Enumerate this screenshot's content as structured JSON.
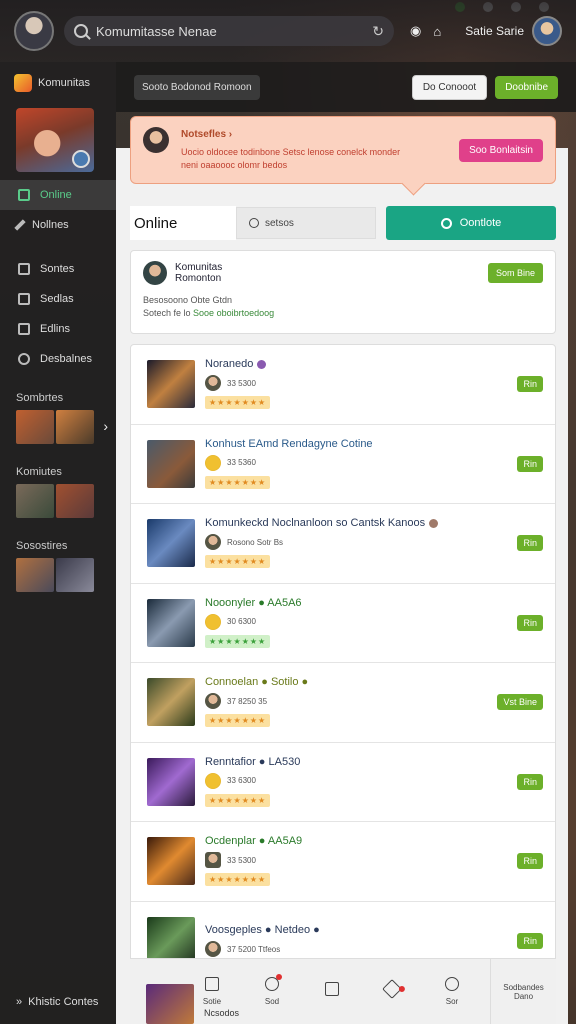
{
  "topbar": {
    "search_text": "Komumitasse Nenae",
    "username": "Satie Sarie",
    "refresh_icon": "refresh-icon",
    "bell_icon": "bell-icon"
  },
  "sidebar": {
    "brand": "Komunitas",
    "items": [
      {
        "label": "Online",
        "icon": "online-icon"
      },
      {
        "label": "Nollnes",
        "icon": "pencil-icon"
      },
      {
        "label": "Sontes",
        "icon": "grid-icon"
      },
      {
        "label": "Sedlas",
        "icon": "list-icon"
      },
      {
        "label": "Edlins",
        "icon": "edit-icon"
      },
      {
        "label": "Desbalnes",
        "icon": "clock-icon"
      }
    ],
    "sections": [
      "Sombrtes",
      "Komiutes",
      "Sosostires"
    ],
    "footer": "Khistic Contes"
  },
  "main_header": {
    "pill": "Sooto Bodonod Romoon",
    "btn_white": "Do Conooot",
    "btn_green": "Doobnibe"
  },
  "notification": {
    "title": "Notsefles",
    "body_1": "Uocio oldocee todinbone Setsc lenose conelck monder",
    "body_2": "neni oaaoooc olomr bedos",
    "button": "Soo Bonlaitsin"
  },
  "tabs": {
    "online": "Online",
    "search": "setsos",
    "search_button": "Oontlote"
  },
  "community_card": {
    "name_1": "Komunitas",
    "name_2": "Romonton",
    "button": "Som Bine",
    "line1": "Besosoono Obte Gtdn",
    "line2_prefix": "Sotech fe lo",
    "line2_highlight": "Sooe oboibrtoedoog"
  },
  "games": [
    {
      "title": "Noranedo",
      "meta": "33 5300",
      "stars": "★★★★★★★",
      "button": "Rin",
      "title_color": "#2a3a5a",
      "dot": "#8a5ab0",
      "star_style": "orange"
    },
    {
      "title": "Konhust EAmd Rendagyne Cotine",
      "meta": "33 5360",
      "stars": "★★★★★★★",
      "button": "Rin",
      "title_color": "#2a5a8a",
      "dot": "",
      "star_style": "orange"
    },
    {
      "title": "Komunkeckd Noclnanloon so Cantsk Kanoos",
      "meta": "Rosono Sotr Bs",
      "stars": "★★★★★★★",
      "button": "Rin",
      "title_color": "#2a3a5a",
      "dot": "#a07a6a",
      "star_style": "orange"
    },
    {
      "title": "Nooonyler ● AA5A6",
      "meta": "30 6300",
      "stars": "★★★★★★★",
      "button": "Rin",
      "title_color": "#2a7a2a",
      "dot": "",
      "star_style": "green"
    },
    {
      "title": "Connoelan ● Sotilo ●",
      "meta": "37 8250 35",
      "stars": "★★★★★★★",
      "button": "Vst Bine",
      "title_color": "#6a7a1a",
      "dot": "",
      "star_style": "orange"
    },
    {
      "title": "Renntafior ● LA530",
      "meta": "33 6300",
      "stars": "★★★★★★★",
      "button": "Rin",
      "title_color": "#2a3a5a",
      "dot": "",
      "star_style": "orange"
    },
    {
      "title": "Ocdenplar ● AA5A9",
      "meta": "33 5300",
      "stars": "★★★★★★★",
      "button": "Rin",
      "title_color": "#2a7a2a",
      "dot": "",
      "star_style": "orange"
    },
    {
      "title": "Voosgeples ● Netdeo ●",
      "meta": "37 5200 Ttfeos",
      "stars": "★★★★★★★",
      "button": "Rin",
      "title_color": "#2a3a5a",
      "dot": "",
      "star_style": "orange"
    }
  ],
  "bottom_nav": {
    "items": [
      {
        "label": "Sotie",
        "icon": "home-icon"
      },
      {
        "label": "Sod",
        "icon": "chat-icon"
      },
      {
        "label": "",
        "icon": "image-icon"
      },
      {
        "label": "",
        "icon": "tag-icon"
      },
      {
        "label": "Sor",
        "icon": "globe-icon"
      }
    ],
    "right_1": "Sodbandes",
    "right_2": "Dano",
    "caption": "Ncsodos"
  }
}
